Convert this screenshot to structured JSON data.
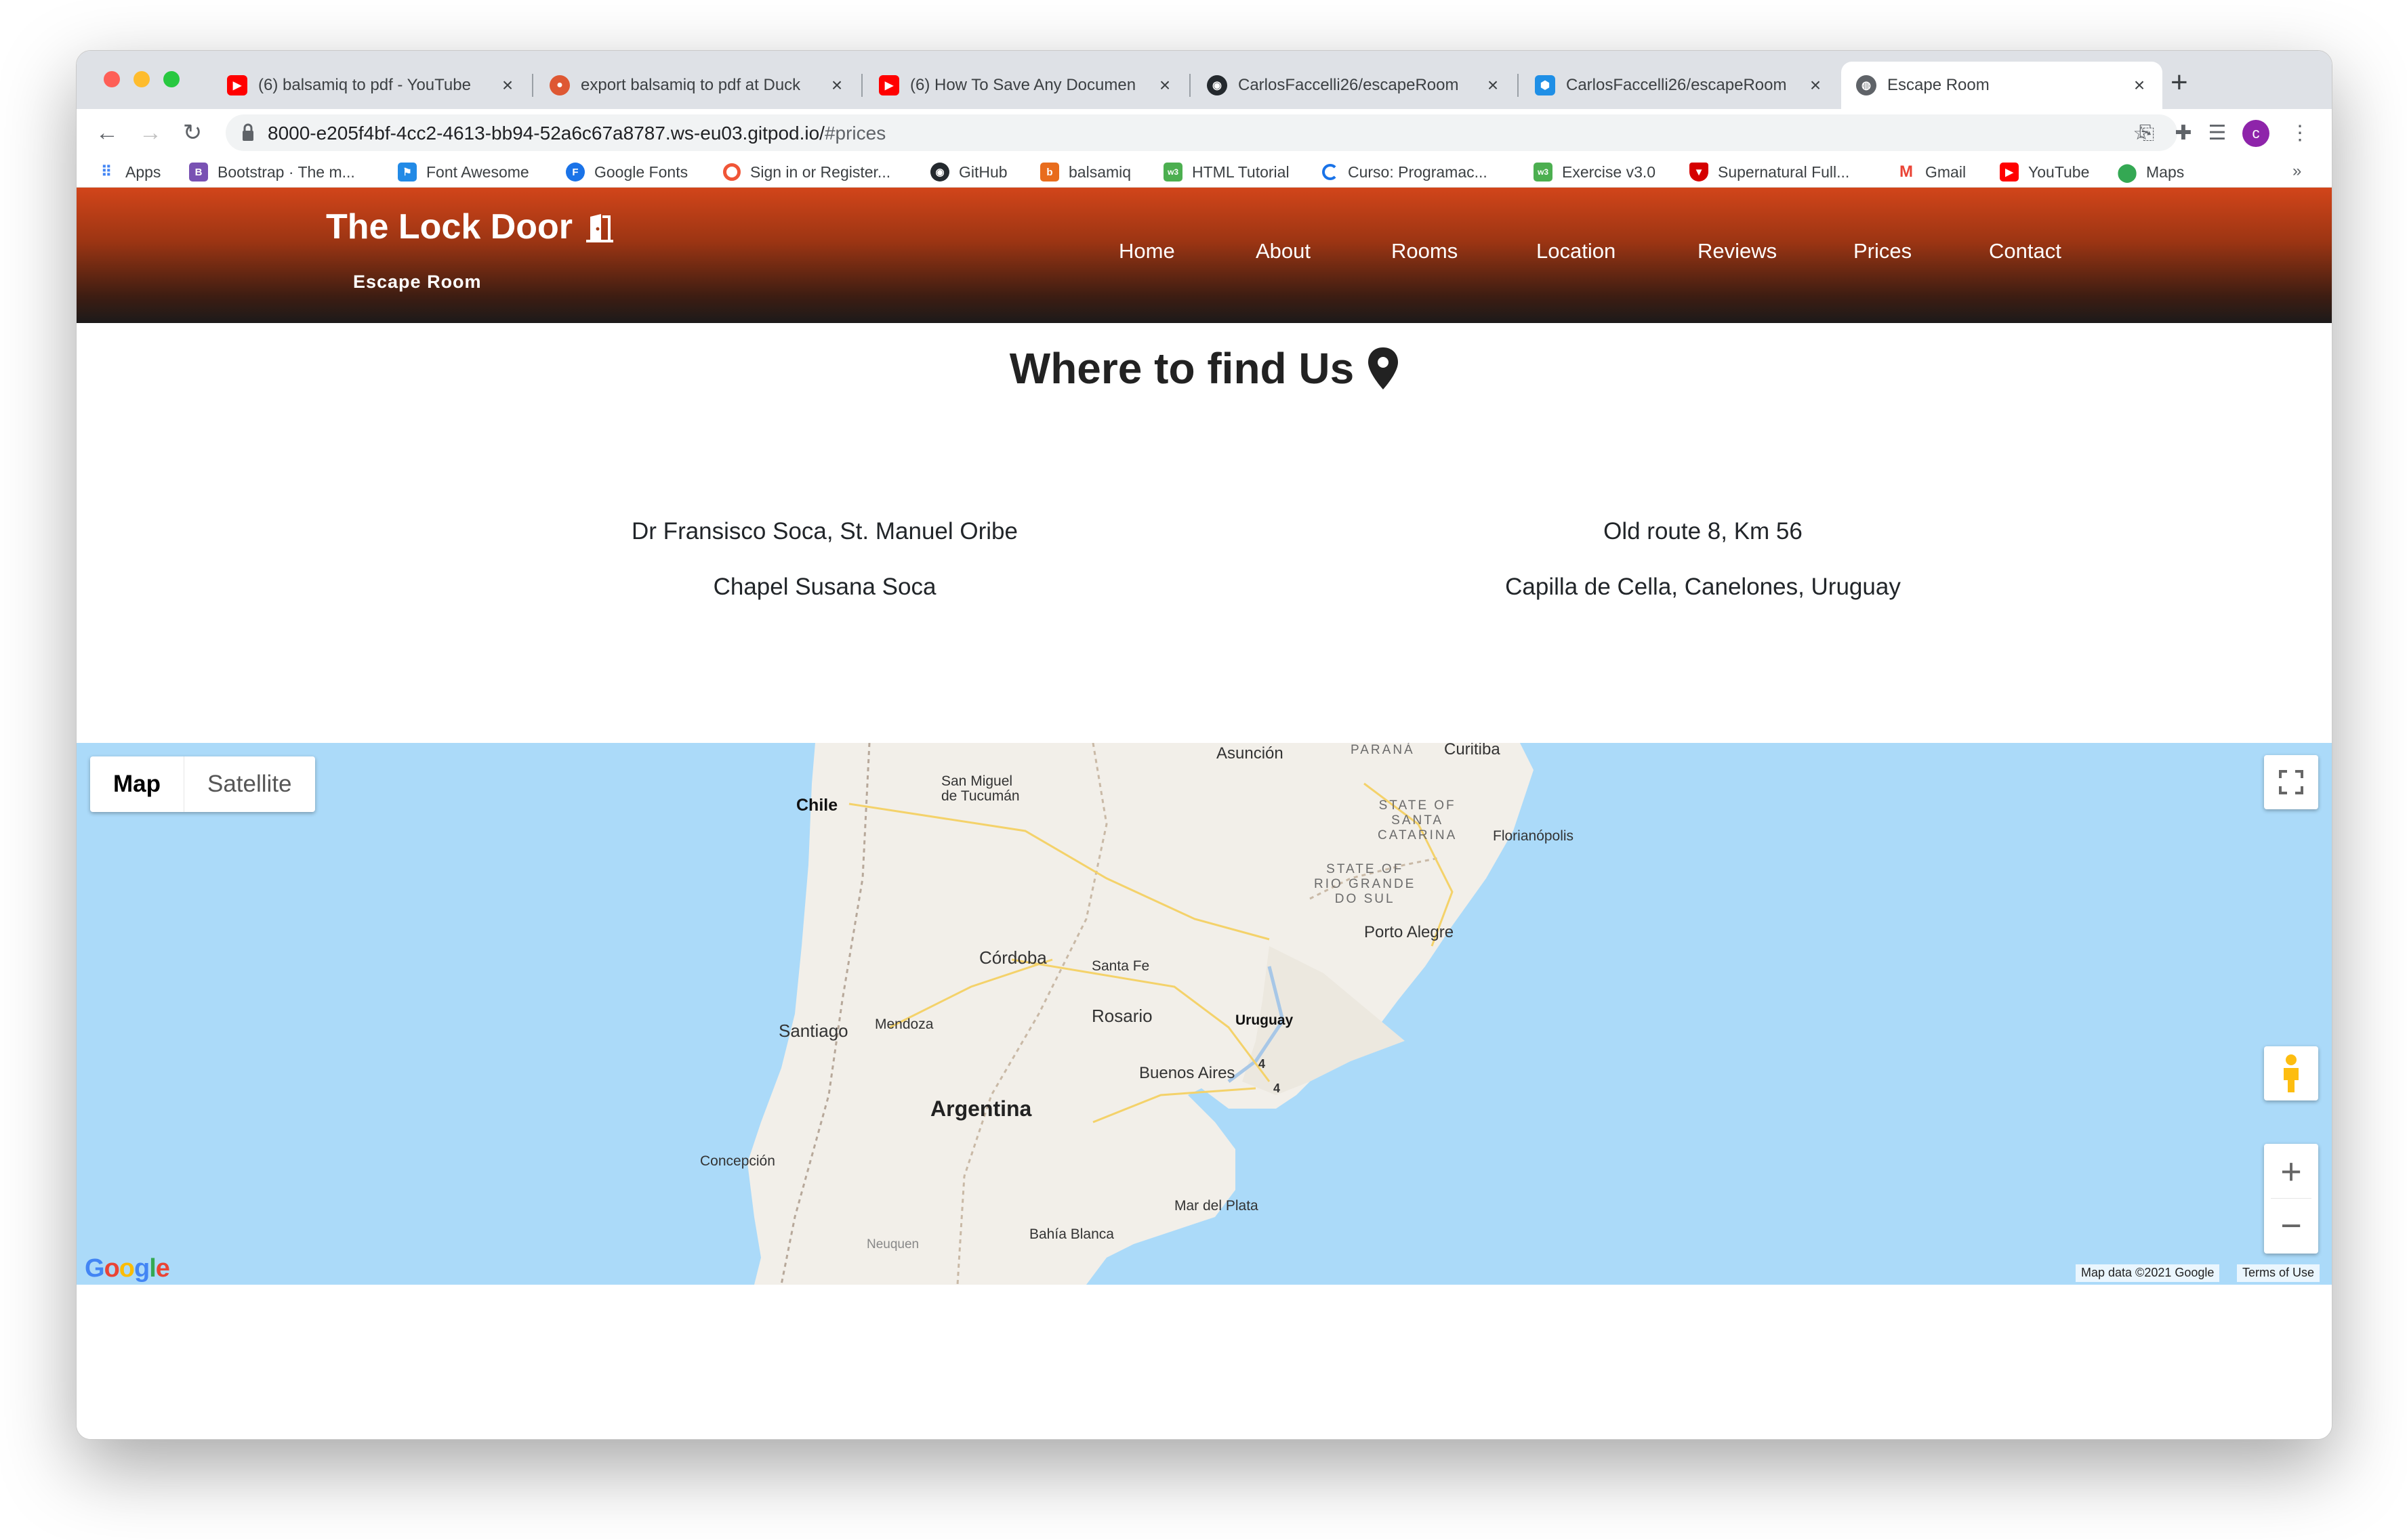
{
  "browser": {
    "tabs": [
      {
        "title": "(6) balsamiq to pdf - YouTube",
        "icon": "youtube-icon"
      },
      {
        "title": "export balsamiq to pdf at Duck",
        "icon": "duckduckgo-icon"
      },
      {
        "title": "(6) How To Save Any Documen",
        "icon": "youtube-icon"
      },
      {
        "title": "CarlosFaccelli26/escapeRoom",
        "icon": "github-icon"
      },
      {
        "title": "CarlosFaccelli26/escapeRoom",
        "icon": "gitpod-icon"
      },
      {
        "title": "Escape Room",
        "icon": "globe-icon"
      }
    ],
    "url_main": "8000-e205f4bf-4cc2-4613-bb94-52a6c67a8787.ws-eu03.gitpod.io/",
    "url_hash": "#prices",
    "avatar_letter": "c",
    "bookmarks": [
      {
        "label": "Apps",
        "icon": "apps-grid-icon",
        "color": "#4285f4"
      },
      {
        "label": "Bootstrap · The m...",
        "icon": "bootstrap-icon",
        "color": "#7952b3"
      },
      {
        "label": "Font Awesome",
        "icon": "flag-icon",
        "color": "#228ae6"
      },
      {
        "label": "Google Fonts",
        "icon": "google-fonts-icon",
        "color": "#1a73e8"
      },
      {
        "label": "Sign in or Register...",
        "icon": "circle-icon",
        "color": "#f05537"
      },
      {
        "label": "GitHub",
        "icon": "github-icon",
        "color": "#24292e"
      },
      {
        "label": "balsamiq",
        "icon": "balsamiq-icon",
        "color": "#e86c1d"
      },
      {
        "label": "HTML Tutorial",
        "icon": "w3schools-icon",
        "color": "#4caf50"
      },
      {
        "label": "Curso: Programac...",
        "icon": "loading-icon",
        "color": "#1a73e8"
      },
      {
        "label": "Exercise v3.0",
        "icon": "w3schools-icon",
        "color": "#4caf50"
      },
      {
        "label": "Supernatural Full...",
        "icon": "shield-icon",
        "color": "#d50000"
      },
      {
        "label": "Gmail",
        "icon": "gmail-icon",
        "color": "#ea4335"
      },
      {
        "label": "YouTube",
        "icon": "youtube-icon",
        "color": "#ff0000"
      },
      {
        "label": "Maps",
        "icon": "maps-pin-icon",
        "color": "#34a853"
      }
    ],
    "bookmarks_more": "»"
  },
  "site": {
    "brand": "The Lock Door",
    "brand_sub": "Escape Room",
    "nav": [
      "Home",
      "About",
      "Rooms",
      "Location",
      "Reviews",
      "Prices",
      "Contact"
    ],
    "gradient_top": "#d2451a",
    "gradient_bottom": "#1c1a1a"
  },
  "location": {
    "title": "Where to find Us",
    "left": [
      "Dr Fransisco Soca, St. Manuel Oribe",
      "Chapel Susana Soca"
    ],
    "right": [
      "Old route 8, Km 56",
      "Capilla de Cella, Canelones, Uruguay"
    ]
  },
  "map": {
    "type_buttons": [
      "Map",
      "Satellite"
    ],
    "selected_type": "Map",
    "labels": {
      "asuncion": "Asunción",
      "parana": "PARANÁ",
      "curitiba": "Curitiba",
      "tucuman": "San Miguel\nde Tucumán",
      "chile": "Chile",
      "santa_catarina": "STATE OF\nSANTA\nCATARINA",
      "florianopolis": "Florianópolis",
      "rio_grande": "STATE OF\nRIO GRANDE\nDO SUL",
      "porto_alegre": "Porto Alegre",
      "cordoba": "Córdoba",
      "santa_fe": "Santa Fe",
      "rosario": "Rosario",
      "uruguay": "Uruguay",
      "santiago": "Santiago",
      "mendoza": "Mendoza",
      "buenos_aires": "Buenos Aires",
      "argentina": "Argentina",
      "concepcion": "Concepción",
      "mar_del_plata": "Mar del Plata",
      "bahia_blanca": "Bahía Blanca",
      "neuquen": "Neuquen",
      "route_4a": "4",
      "route_4b": "4"
    },
    "google": "Google",
    "attribution": "Map data ©2021 Google",
    "terms": "Terms of Use",
    "water_color": "#abdaf9",
    "land_color": "#f2efe9"
  }
}
